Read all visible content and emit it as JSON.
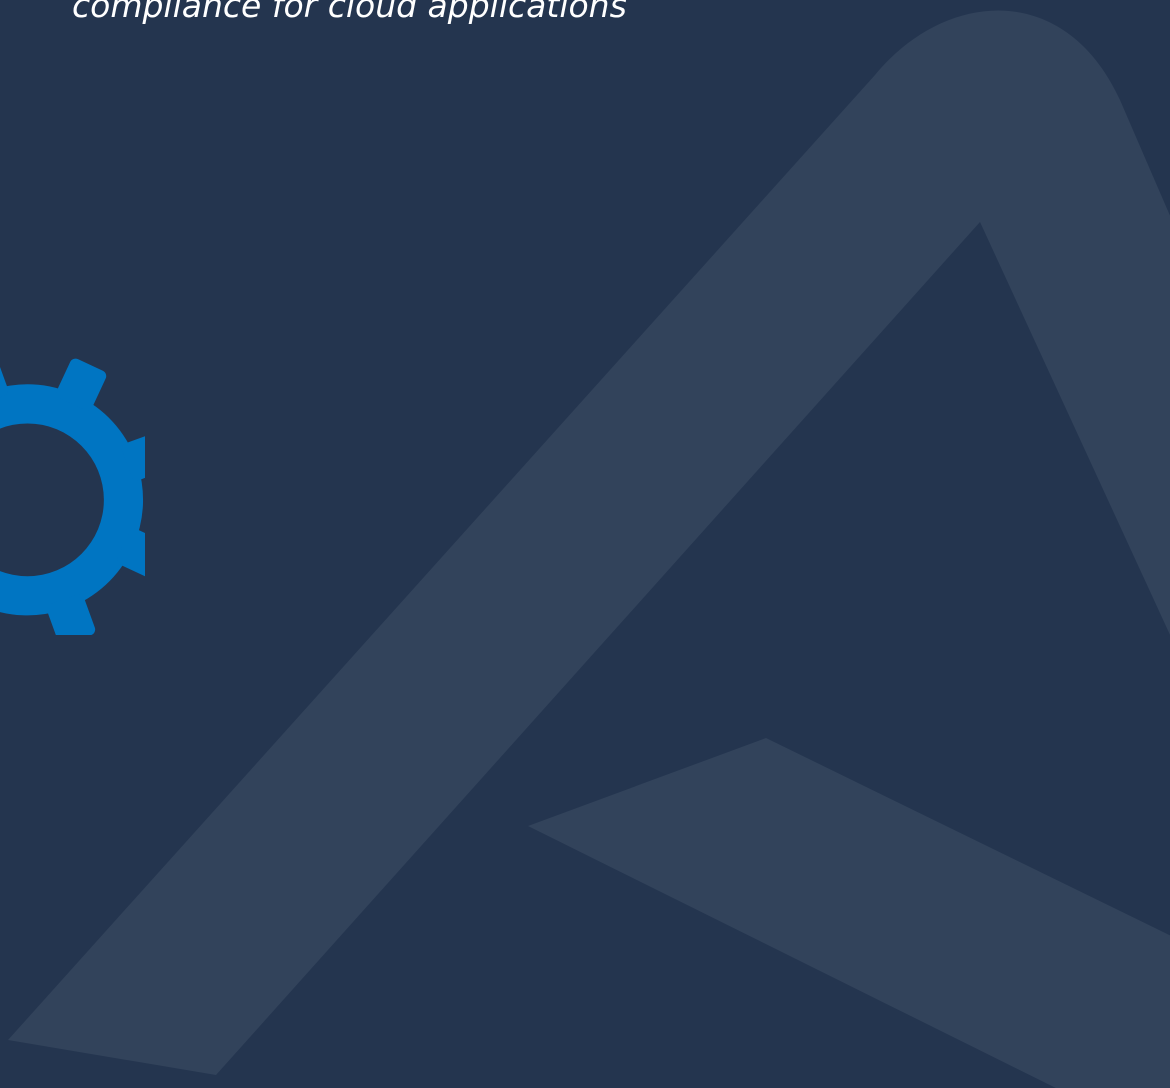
{
  "hero": {
    "tagline_fragment": "compliance for cloud applications"
  },
  "icons": {
    "gear": "gear-icon",
    "brand_mark": "brand-logo-mark"
  },
  "colors": {
    "background": "#24354f",
    "brand_mark": "#32435b",
    "accent": "#0075c2",
    "text": "#ffffff"
  }
}
